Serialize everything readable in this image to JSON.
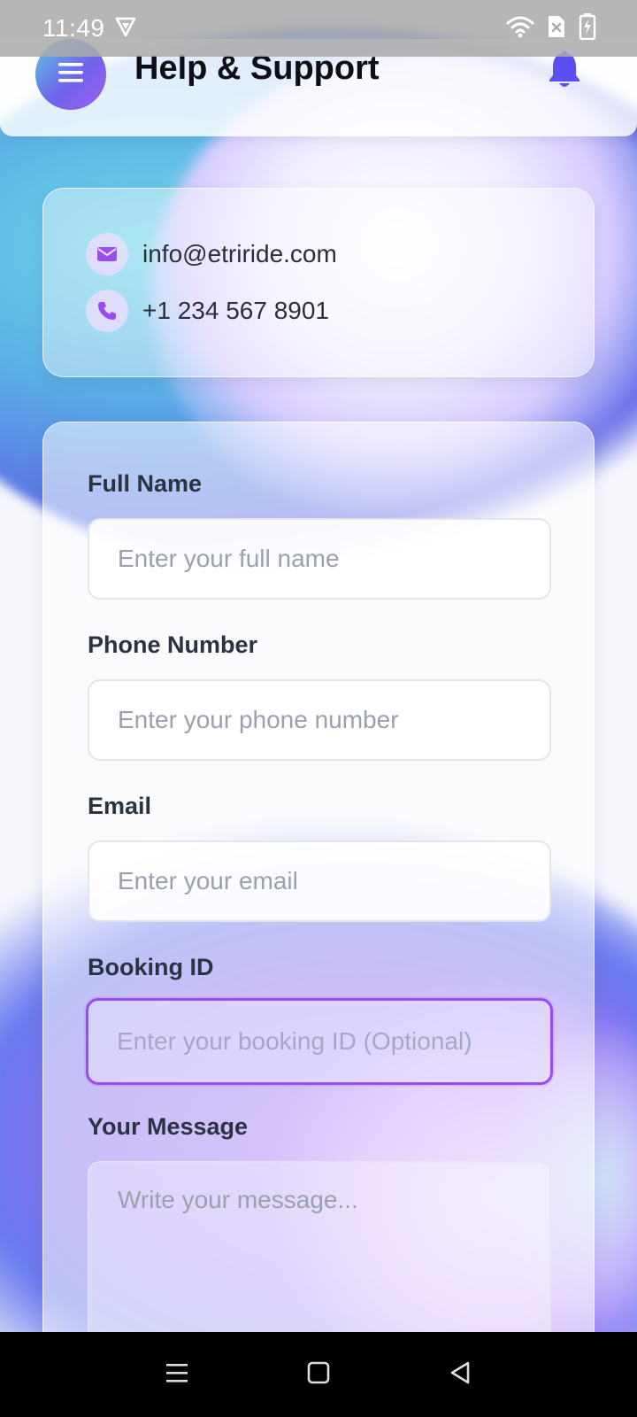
{
  "status_bar": {
    "time": "11:49"
  },
  "header": {
    "title": "Help & Support",
    "menu_icon": "hamburger-menu-icon",
    "bell_icon": "bell-icon"
  },
  "contact": {
    "email": "info@etriride.com",
    "phone": "+1 234 567 8901"
  },
  "form": {
    "full_name": {
      "label": "Full Name",
      "placeholder": "Enter your full name",
      "value": ""
    },
    "phone": {
      "label": "Phone Number",
      "placeholder": "Enter your phone number",
      "value": ""
    },
    "email": {
      "label": "Email",
      "placeholder": "Enter your email",
      "value": ""
    },
    "booking_id": {
      "label": "Booking ID",
      "placeholder": "Enter your booking ID (Optional)",
      "value": ""
    },
    "message": {
      "label": "Your Message",
      "placeholder": "Write your message...",
      "value": ""
    }
  },
  "colors": {
    "accent": "#9b4cf0",
    "bell": "#5a4ff0",
    "icon": "#9b4cf0"
  }
}
